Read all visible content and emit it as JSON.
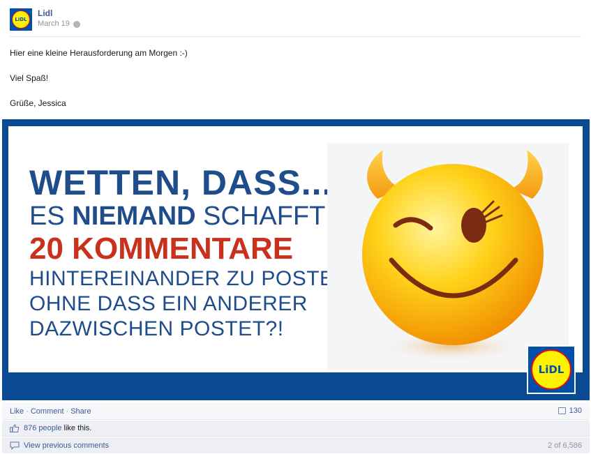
{
  "post": {
    "author": "Lidl",
    "date": "March 19",
    "avatar_text": "LiDL",
    "text_lines": [
      "Hier eine kleine Herausforderung am Morgen :-)",
      "Viel Spaß!",
      "Grüße, Jessica"
    ]
  },
  "banner": {
    "line1": "WETTEN, DASS...",
    "line2_pre": "ES ",
    "line2_bold": "NIEMAND",
    "line2_post": " SCHAFFT",
    "line3": "20 KOMMENTARE",
    "line4": "HINTEREINANDER ZU POSTEN,",
    "line5": "OHNE DASS EIN ANDERER",
    "line6": "DAZWISCHEN POSTET?!",
    "logo_text": "LiDL",
    "emoji": "winking-devil-smiley"
  },
  "actions": {
    "like": "Like",
    "comment": "Comment",
    "share": "Share",
    "separator": "·",
    "comment_count": "130"
  },
  "likes": {
    "people_link": "876 people",
    "suffix": " like this."
  },
  "comments": {
    "view_previous": "View previous comments",
    "pager": "2 of 6,586"
  },
  "colors": {
    "fb_blue": "#3b5998",
    "banner_blue": "#0a4a93",
    "banner_text_blue": "#1f4c8a",
    "banner_red": "#c8321d",
    "lidl_yellow": "#fff200",
    "lidl_red": "#e60a14"
  }
}
